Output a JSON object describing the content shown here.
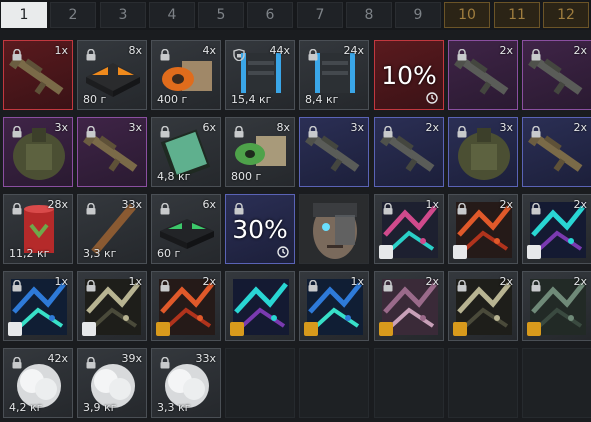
{
  "tabs": [
    {
      "label": "1",
      "state": "active"
    },
    {
      "label": "2",
      "state": "normal"
    },
    {
      "label": "3",
      "state": "normal"
    },
    {
      "label": "4",
      "state": "normal"
    },
    {
      "label": "5",
      "state": "normal"
    },
    {
      "label": "6",
      "state": "normal"
    },
    {
      "label": "7",
      "state": "normal"
    },
    {
      "label": "8",
      "state": "normal"
    },
    {
      "label": "9",
      "state": "normal"
    },
    {
      "label": "10",
      "state": "locked"
    },
    {
      "label": "11",
      "state": "locked"
    },
    {
      "label": "12",
      "state": "locked"
    }
  ],
  "items": [
    {
      "rarity": "red",
      "art": "rifle",
      "qty": "1x",
      "weight": "",
      "lock": true
    },
    {
      "rarity": "gray",
      "art": "orange-case",
      "qty": "8x",
      "weight": "80 г",
      "lock": true
    },
    {
      "rarity": "gray",
      "art": "spool-box",
      "qty": "4x",
      "weight": "400 г",
      "lock": true
    },
    {
      "rarity": "gray",
      "art": "blue-container",
      "qty": "44x",
      "weight": "15,4 кг",
      "lock": true,
      "shield": true
    },
    {
      "rarity": "gray",
      "art": "blue-container",
      "qty": "24x",
      "weight": "8,4 кг",
      "lock": true
    },
    {
      "rarity": "red",
      "art": "",
      "qty": "",
      "weight": "",
      "lock": false,
      "percent": "10%",
      "clock": true
    },
    {
      "rarity": "purple",
      "art": "rifle-dark",
      "qty": "2x",
      "weight": "",
      "lock": true
    },
    {
      "rarity": "purple",
      "art": "rifle-dark",
      "qty": "2x",
      "weight": "",
      "lock": true
    },
    {
      "rarity": "purple",
      "art": "armor",
      "qty": "3x",
      "weight": "",
      "lock": true
    },
    {
      "rarity": "purple",
      "art": "rifle",
      "qty": "3x",
      "weight": "",
      "lock": true
    },
    {
      "rarity": "gray",
      "art": "green-book",
      "qty": "6x",
      "weight": "4,8 кг",
      "lock": true
    },
    {
      "rarity": "gray",
      "art": "green-spool",
      "qty": "8x",
      "weight": "800 г",
      "lock": true
    },
    {
      "rarity": "blue",
      "art": "rifle-dark",
      "qty": "3x",
      "weight": "",
      "lock": true
    },
    {
      "rarity": "blue",
      "art": "rifle-dark",
      "qty": "2x",
      "weight": "",
      "lock": true
    },
    {
      "rarity": "blue",
      "art": "armor",
      "qty": "3x",
      "weight": "",
      "lock": true
    },
    {
      "rarity": "blue",
      "art": "rifle",
      "qty": "2x",
      "weight": "",
      "lock": true
    },
    {
      "rarity": "gray",
      "art": "red-can",
      "qty": "28x",
      "weight": "11,2 кг",
      "lock": true
    },
    {
      "rarity": "gray",
      "art": "stick",
      "qty": "33x",
      "weight": "3,3 кг",
      "lock": true
    },
    {
      "rarity": "gray",
      "art": "green-case",
      "qty": "6x",
      "weight": "60 г",
      "lock": true
    },
    {
      "rarity": "blue",
      "art": "",
      "qty": "",
      "weight": "",
      "lock": true,
      "percent": "30%",
      "clock": true
    },
    {
      "rarity": "dark",
      "art": "cyborg-face",
      "qty": "",
      "weight": "",
      "lock": false
    },
    {
      "rarity": "gray",
      "art": "camo-pink",
      "qty": "1x",
      "weight": "",
      "lock": true,
      "badge": "white"
    },
    {
      "rarity": "gray",
      "art": "camo-orange",
      "qty": "2x",
      "weight": "",
      "lock": true,
      "badge": "white"
    },
    {
      "rarity": "gray",
      "art": "camo-cyan",
      "qty": "2x",
      "weight": "",
      "lock": true,
      "badge": "white"
    },
    {
      "rarity": "gray",
      "art": "camo-blue",
      "qty": "1x",
      "weight": "",
      "lock": true,
      "badge": "white"
    },
    {
      "rarity": "gray",
      "art": "camo-star",
      "qty": "1x",
      "weight": "",
      "lock": true,
      "badge": "white"
    },
    {
      "rarity": "gray",
      "art": "camo-orange",
      "qty": "2x",
      "weight": "",
      "lock": true,
      "badge": "gold"
    },
    {
      "rarity": "gray",
      "art": "camo-cyan",
      "qty": "",
      "weight": "",
      "lock": false,
      "badge": "gold"
    },
    {
      "rarity": "gray",
      "art": "camo-blue",
      "qty": "1x",
      "weight": "",
      "lock": true,
      "badge": "gold"
    },
    {
      "rarity": "gray",
      "art": "camo-pink2",
      "qty": "2x",
      "weight": "",
      "lock": true,
      "badge": "gold"
    },
    {
      "rarity": "gray",
      "art": "camo-star",
      "qty": "2x",
      "weight": "",
      "lock": true,
      "badge": "gold"
    },
    {
      "rarity": "gray",
      "art": "camo-green",
      "qty": "2x",
      "weight": "",
      "lock": true,
      "badge": "gold"
    },
    {
      "rarity": "gray",
      "art": "cloud",
      "qty": "42x",
      "weight": "4,2 кг",
      "lock": true
    },
    {
      "rarity": "gray",
      "art": "cloud",
      "qty": "39x",
      "weight": "3,9 кг",
      "lock": true
    },
    {
      "rarity": "gray",
      "art": "cloud",
      "qty": "33x",
      "weight": "3,3 кг",
      "lock": true
    },
    {
      "rarity": "empty"
    },
    {
      "rarity": "empty"
    },
    {
      "rarity": "empty"
    },
    {
      "rarity": "empty"
    },
    {
      "rarity": "empty"
    }
  ]
}
